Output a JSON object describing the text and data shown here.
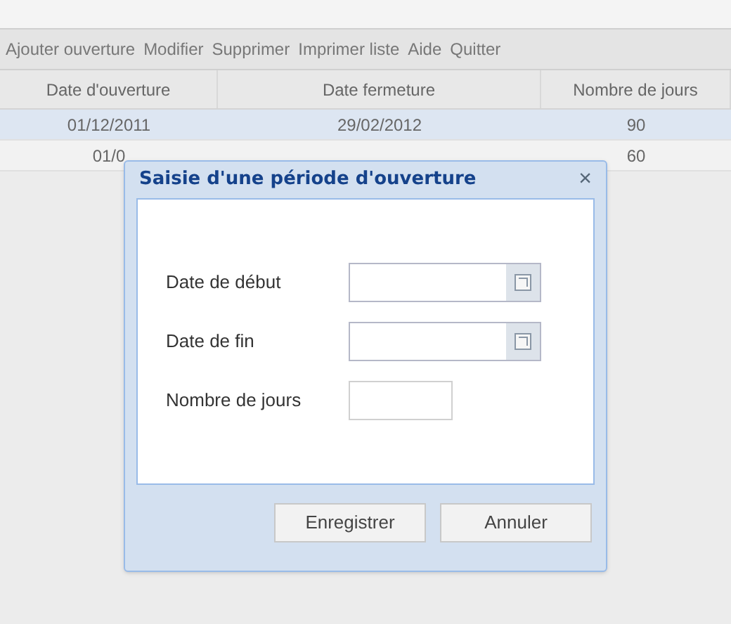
{
  "toolbar": [
    "Ajouter ouverture",
    "Modifier",
    "Supprimer",
    "Imprimer liste",
    "Aide",
    "Quitter"
  ],
  "table": {
    "columns": [
      "Date d'ouverture",
      "Date fermeture",
      "Nombre de jours"
    ],
    "rows": [
      {
        "cells": [
          "01/12/2011",
          "29/02/2012",
          "90"
        ],
        "selected": true
      },
      {
        "cells": [
          "01/0",
          "",
          "60"
        ],
        "selected": false
      }
    ]
  },
  "dialog": {
    "title": "Saisie d'une période d'ouverture",
    "close": "×",
    "fields": [
      {
        "kind": "date",
        "label": "Date de début"
      },
      {
        "kind": "date",
        "label": "Date de fin"
      },
      {
        "kind": "text",
        "label": "Nombre de jours"
      }
    ],
    "buttons": [
      "Enregistrer",
      "Annuler"
    ]
  }
}
